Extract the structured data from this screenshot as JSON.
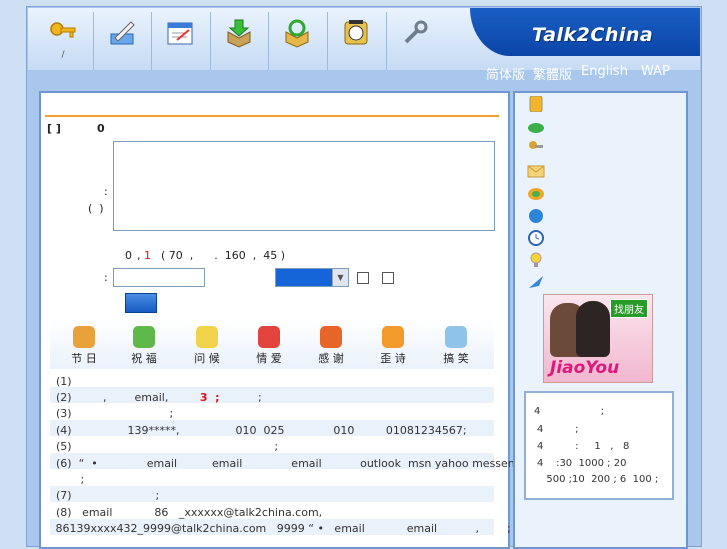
{
  "brand": {
    "logo_text": "Talk2China"
  },
  "toolbar": {
    "slash": "/",
    "buttons": [
      {
        "name": "key-icon"
      },
      {
        "name": "pen-icon"
      },
      {
        "name": "notepad-icon"
      },
      {
        "name": "download-icon"
      },
      {
        "name": "refresh-icon"
      },
      {
        "name": "web-icon"
      },
      {
        "name": "tools-icon"
      }
    ]
  },
  "languages": [
    "简体版",
    "繁體版",
    "English",
    "WAP"
  ],
  "form": {
    "bracket_label": "[ ]",
    "zero": "0",
    "colon_label": ":",
    "paren_label": "(  )",
    "counter_zero": "0",
    "counter_sep": ",",
    "counter_one": "1",
    "counter_rest": "( 70  ,      .  160  ,  45 )",
    "sender_colon": ":",
    "input_value": "",
    "select_value": ""
  },
  "categories": [
    "节 日",
    "祝 福",
    "问 候",
    "情 爱",
    "感 谢",
    "歪 诗",
    "搞 笑"
  ],
  "rules": [
    {
      "text": "(1)"
    },
    {
      "text": "(2)         ,        email,         ",
      "highlight": "3  ;",
      "tail": "           ;"
    },
    {
      "text": "(3)                            ;"
    },
    {
      "text": "(4)                139*****,                010  025              010         01081234567;"
    },
    {
      "text": "(5)                                                          ;"
    },
    {
      "text": "(6)  “  •              email          email              email           outlook  msn yahoo messenger"
    },
    {
      "text": "       ;"
    },
    {
      "text": "(7)                        ;"
    },
    {
      "text": "(8)   email            86   _xxxxxx@talk2china.com,"
    },
    {
      "text": " 86139xxxx432_9999@talk2china.com   9999 “ •   email            email           ,        ;"
    }
  ],
  "side_icons": [
    "mobile-icon",
    "bird-icon",
    "keys-icon",
    "envelope-icon",
    "chat-icon",
    "globe-icon",
    "clock-icon",
    "bulb-icon",
    "feather-icon"
  ],
  "ad": {
    "tag": "找朋友",
    "brand": "JiaoYou"
  },
  "notes": [
    "4                   ;",
    "4          ;",
    "4          :     1   ,   8",
    "4    :30  1000 ; 20",
    "  500 ;10  200 ; 6  100 ;"
  ],
  "colors": {
    "accent": "#f0a030",
    "brand_blue": "#0b45a8",
    "highlight_red": "#e01010"
  }
}
